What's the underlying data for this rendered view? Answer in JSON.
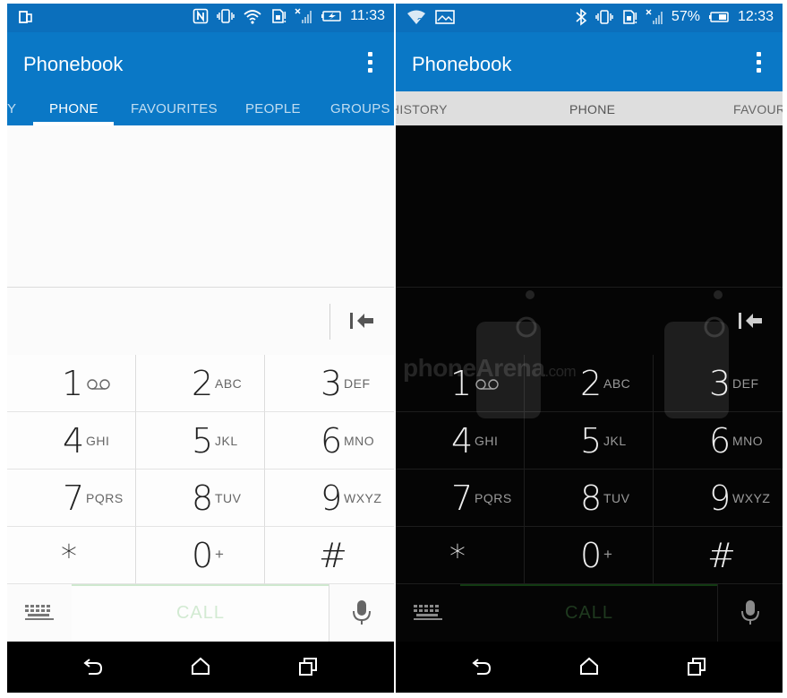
{
  "light": {
    "status": {
      "time": "11:33"
    },
    "app_title": "Phonebook",
    "tabs": [
      "Y",
      "PHONE",
      "FAVOURITES",
      "PEOPLE",
      "GROUPS"
    ],
    "active_tab": "PHONE",
    "keys": [
      {
        "digit": "1",
        "letters": "",
        "icon": "voicemail-icon"
      },
      {
        "digit": "2",
        "letters": "ABC"
      },
      {
        "digit": "3",
        "letters": "DEF"
      },
      {
        "digit": "4",
        "letters": "GHI"
      },
      {
        "digit": "5",
        "letters": "JKL"
      },
      {
        "digit": "6",
        "letters": "MNO"
      },
      {
        "digit": "7",
        "letters": "PQRS"
      },
      {
        "digit": "8",
        "letters": "TUV"
      },
      {
        "digit": "9",
        "letters": "WXYZ"
      },
      {
        "digit": "*",
        "letters": ""
      },
      {
        "digit": "0",
        "letters": "+"
      },
      {
        "digit": "#",
        "letters": ""
      }
    ],
    "call_label": "CALL",
    "icons": {
      "status": [
        "screen-mirror-icon",
        "nfc-icon",
        "vibrate-icon",
        "wifi-icon",
        "sim-icon",
        "no-signal-icon",
        "battery-charging-icon"
      ],
      "backspace": "backspace-icon",
      "keyboard": "keyboard-icon",
      "mic": "microphone-icon",
      "nav": [
        "back-icon",
        "home-icon",
        "recents-icon"
      ]
    }
  },
  "dark": {
    "status": {
      "time": "12:33",
      "battery": "57%"
    },
    "app_title": "Phonebook",
    "tabs": [
      "HISTORY",
      "PHONE",
      "FAVOUR"
    ],
    "active_tab": "PHONE",
    "keys": [
      {
        "digit": "1",
        "letters": "",
        "icon": "voicemail-icon"
      },
      {
        "digit": "2",
        "letters": "ABC"
      },
      {
        "digit": "3",
        "letters": "DEF"
      },
      {
        "digit": "4",
        "letters": "GHI"
      },
      {
        "digit": "5",
        "letters": "JKL"
      },
      {
        "digit": "6",
        "letters": "MNO"
      },
      {
        "digit": "7",
        "letters": "PQRS"
      },
      {
        "digit": "8",
        "letters": "TUV"
      },
      {
        "digit": "9",
        "letters": "WXYZ"
      },
      {
        "digit": "*",
        "letters": ""
      },
      {
        "digit": "0",
        "letters": "+"
      },
      {
        "digit": "#",
        "letters": ""
      }
    ],
    "call_label": "CALL",
    "watermark": {
      "brand": "phoneArena",
      "suffix": ".com"
    },
    "icons": {
      "status": [
        "wifi-question-icon",
        "image-notification-icon",
        "bluetooth-icon",
        "vibrate-icon",
        "sim-icon",
        "no-signal-icon",
        "battery-icon"
      ]
    }
  },
  "colors": {
    "status_bar": "#0b6fbc",
    "app_bar": "#0a78c6",
    "dark_tab_bar": "#dedede",
    "call_text_light": "#d2ead2",
    "call_text_dark": "#1f3a1f"
  }
}
